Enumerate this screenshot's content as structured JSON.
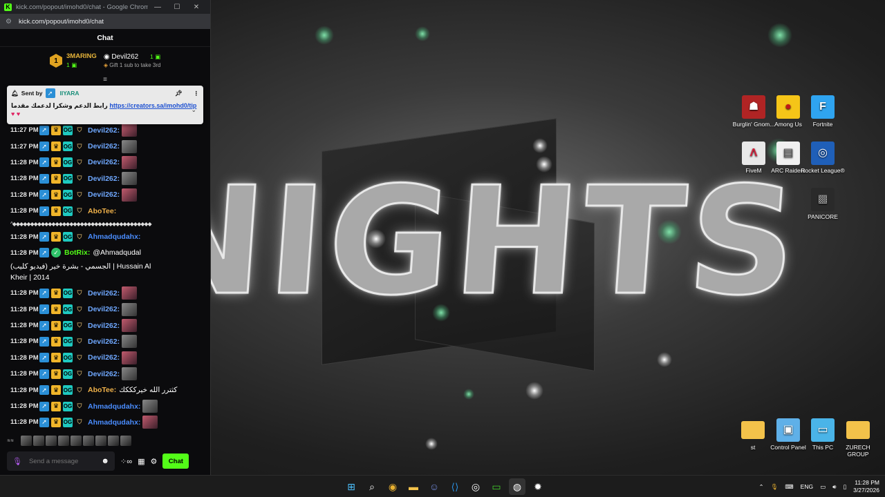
{
  "browser": {
    "window_title": "kick.com/popout/imohd0/chat - Google Chrome",
    "url": "kick.com/popout/imohd0/chat"
  },
  "chat": {
    "header": "Chat",
    "leaderboard": {
      "rank": "1",
      "first_name": "3MARING",
      "first_count": "1",
      "second_name": "Devil262",
      "second_count": "1",
      "hint": "Gift 1 sub to take 3rd"
    },
    "pinned": {
      "sent_by_label": "Sent by",
      "author": "IIYARA",
      "message_prefix": "رابط الدعم وشكرا لدعمك مقدما",
      "link": "https://creators.sa/imohd0/tip"
    },
    "messages": [
      {
        "time": "11:27 PM",
        "user": "Devil262:",
        "color": "#6fa8ff",
        "text": "",
        "emote": true
      },
      {
        "time": "11:27 PM",
        "user": "Devil262:",
        "color": "#6fa8ff",
        "text": "",
        "emote": true
      },
      {
        "time": "11:28 PM",
        "user": "Devil262:",
        "color": "#6fa8ff",
        "text": "",
        "emote": true
      },
      {
        "time": "11:28 PM",
        "user": "Devil262:",
        "color": "#6fa8ff",
        "text": "",
        "emote": true
      },
      {
        "time": "11:28 PM",
        "user": "Devil262:",
        "color": "#6fa8ff",
        "text": "",
        "emote": true
      },
      {
        "time": "11:28 PM",
        "user": "AboTee:",
        "color": "#f0b24a",
        "text": "",
        "emote": false
      }
    ],
    "dots_line": "^◆◆◆◆◆◆◆◆◆◆◆◆◆◆◆◆◆◆◆◆◆◆◆◆◆◆◆◆◆◆◆◆◆◆◆◆◆◆◆",
    "messages2": [
      {
        "time": "11:28 PM",
        "user": "Ahmadqudahx:",
        "color": "#4a8dff",
        "text": "",
        "emote": false
      }
    ],
    "botrix": {
      "time": "11:28 PM",
      "user": "BotRix:",
      "line1": "@Ahmadqudal",
      "line2": "الجسمي - بشرة خير (فيديو كليب) | Hussain Al",
      "line3": "Kheir | 2014"
    },
    "messages3": [
      {
        "time": "11:28 PM",
        "user": "Devil262:",
        "color": "#6fa8ff",
        "text": "",
        "emote": true
      },
      {
        "time": "11:28 PM",
        "user": "Devil262:",
        "color": "#6fa8ff",
        "text": "",
        "emote": true
      },
      {
        "time": "11:28 PM",
        "user": "Devil262:",
        "color": "#6fa8ff",
        "text": "",
        "emote": true
      },
      {
        "time": "11:28 PM",
        "user": "Devil262:",
        "color": "#6fa8ff",
        "text": "",
        "emote": true
      },
      {
        "time": "11:28 PM",
        "user": "Devil262:",
        "color": "#6fa8ff",
        "text": "",
        "emote": true
      },
      {
        "time": "11:28 PM",
        "user": "Devil262:",
        "color": "#6fa8ff",
        "text": "",
        "emote": true
      },
      {
        "time": "11:28 PM",
        "user": "AboTee:",
        "color": "#f0b24a",
        "text": "كثترر الله خيركككك",
        "emote": false
      },
      {
        "time": "11:28 PM",
        "user": "Ahmadqudahx:",
        "color": "#4a8dff",
        "text": "",
        "emote": true
      },
      {
        "time": "11:28 PM",
        "user": "Ahmadqudahx:",
        "color": "#4a8dff",
        "text": "",
        "emote": true
      }
    ],
    "input_placeholder": "Send a message",
    "send_label": "Chat"
  },
  "wallpaper": {
    "title": "NIGHTS"
  },
  "desktop_icons": [
    {
      "label": "Burglin' Gnom...",
      "name": "burglin-gnomes-icon",
      "bg": "#b02424",
      "glyph": "☗"
    },
    {
      "label": "Among Us",
      "name": "among-us-icon",
      "bg": "#f5c518",
      "glyph": "●"
    },
    {
      "label": "Fortnite",
      "name": "fortnite-icon",
      "bg": "#2fa4f0",
      "glyph": "F"
    },
    {
      "label": "FiveM",
      "name": "fivem-icon",
      "bg": "#e8e8e8",
      "glyph": "Λ"
    },
    {
      "label": "ARC Raiders",
      "name": "arc-raiders-icon",
      "bg": "#f0f0f0",
      "glyph": "▤"
    },
    {
      "label": "Rocket League®",
      "name": "rocket-league-icon",
      "bg": "#1f5fb8",
      "glyph": "◎"
    },
    {
      "label": "PANICORE",
      "name": "panicore-icon",
      "bg": "#2a2a2a",
      "glyph": "▩"
    },
    {
      "label": "st",
      "name": "folder-st-icon",
      "bg": "#f3c24a",
      "glyph": "▬"
    },
    {
      "label": "Control Panel",
      "name": "control-panel-icon",
      "bg": "#5fb0e8",
      "glyph": "▣"
    },
    {
      "label": "This PC",
      "name": "this-pc-icon",
      "bg": "#4ab4e8",
      "glyph": "▭"
    },
    {
      "label": "ZURECH GROUP",
      "name": "folder-zurech-icon",
      "bg": "#f3c24a",
      "glyph": "▬"
    }
  ],
  "taskbar": {
    "language": "ENG",
    "time": "11:28 PM",
    "date": "3/27/2026"
  }
}
